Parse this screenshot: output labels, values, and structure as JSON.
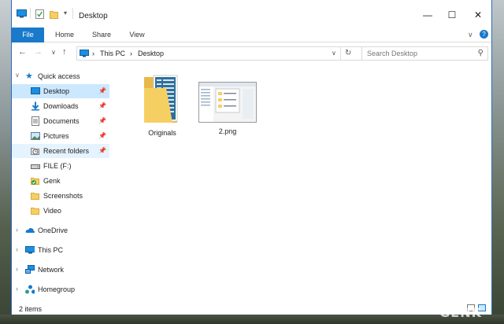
{
  "window": {
    "title": "Desktop",
    "buttons": {
      "minimize": "—",
      "maximize": "☐",
      "close": "✕"
    }
  },
  "ribbon": {
    "tabs": [
      {
        "label": "File"
      },
      {
        "label": "Home"
      },
      {
        "label": "Share"
      },
      {
        "label": "View"
      }
    ],
    "expand_glyph": "∨",
    "help_glyph": "?"
  },
  "address": {
    "segments": [
      "This PC",
      "Desktop"
    ],
    "separator": "›"
  },
  "search": {
    "placeholder": "Search Desktop"
  },
  "nav": {
    "quick_access": "Quick access",
    "items": [
      {
        "label": "Desktop",
        "icon": "desktop-icon",
        "pinned": true
      },
      {
        "label": "Downloads",
        "icon": "download-icon",
        "pinned": true
      },
      {
        "label": "Documents",
        "icon": "documents-icon",
        "pinned": true
      },
      {
        "label": "Pictures",
        "icon": "pictures-icon",
        "pinned": true
      },
      {
        "label": "Recent folders",
        "icon": "recent-folders-icon",
        "pinned": true
      },
      {
        "label": "FILE (F:)",
        "icon": "drive-icon",
        "pinned": false
      },
      {
        "label": "Genk",
        "icon": "folder-sync-icon",
        "pinned": false
      },
      {
        "label": "Screenshots",
        "icon": "folder-icon",
        "pinned": false
      },
      {
        "label": "Video",
        "icon": "folder-icon",
        "pinned": false
      }
    ],
    "roots": [
      {
        "label": "OneDrive",
        "icon": "onedrive-icon"
      },
      {
        "label": "This PC",
        "icon": "this-pc-icon"
      },
      {
        "label": "Network",
        "icon": "network-icon"
      },
      {
        "label": "Homegroup",
        "icon": "homegroup-icon"
      }
    ]
  },
  "files": [
    {
      "name": "Originals",
      "type": "folder"
    },
    {
      "name": "2.png",
      "type": "image"
    }
  ],
  "status": {
    "count": "2 items"
  },
  "watermark": "GENK",
  "colors": {
    "accent": "#1979ca",
    "selected": "#cce8ff",
    "folder": "#f6cf63"
  }
}
